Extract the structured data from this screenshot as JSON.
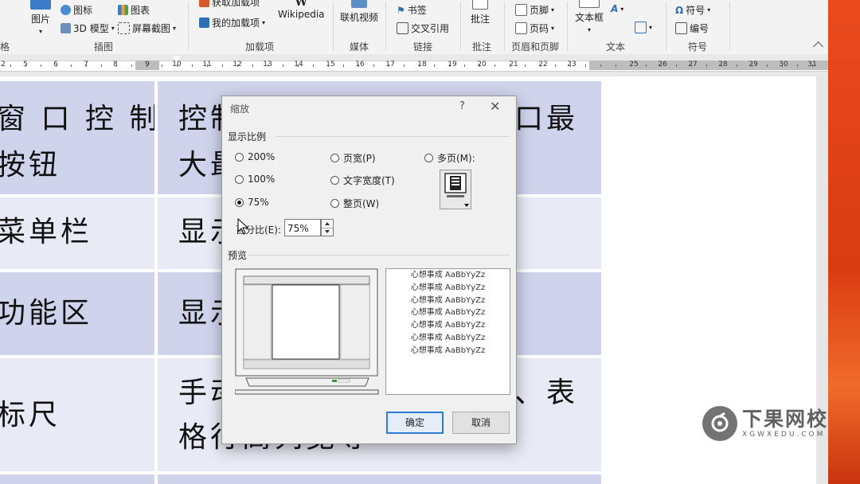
{
  "ribbon": {
    "items": [
      {
        "label": "图片"
      },
      {
        "label": "图标"
      },
      {
        "label": "3D 模型"
      },
      {
        "label": "图表"
      },
      {
        "label": "屏幕截图"
      },
      {
        "label": "获取加载项"
      },
      {
        "label": "我的加载项"
      },
      {
        "label": "Wikipedia"
      },
      {
        "label": "联机视频"
      },
      {
        "label": "书签"
      },
      {
        "label": "交叉引用"
      },
      {
        "label": "批注"
      },
      {
        "label": "页脚"
      },
      {
        "label": "页码"
      },
      {
        "label": "文本框"
      },
      {
        "label": "符号"
      },
      {
        "label": "编号"
      }
    ],
    "groups": [
      {
        "label": "格"
      },
      {
        "label": "插图"
      },
      {
        "label": "加载项"
      },
      {
        "label": "媒体"
      },
      {
        "label": "链接"
      },
      {
        "label": "批注"
      },
      {
        "label": "页眉和页脚"
      },
      {
        "label": "文本"
      },
      {
        "label": "符号"
      }
    ]
  },
  "ruler": {
    "numbers": [
      "1",
      "2",
      "4",
      "5",
      "6",
      "7",
      "8",
      "9",
      "10",
      "11",
      "12",
      "13",
      "14",
      "15",
      "16",
      "17",
      "18",
      "19",
      "20",
      "21",
      "22",
      "23",
      "25",
      "26",
      "27",
      "28",
      "29",
      "30",
      "31",
      "32"
    ]
  },
  "table": {
    "rows": [
      {
        "left": "窗口控制按钮",
        "left_line1": "窗 口 控 制",
        "left_line2": "按钮",
        "right_line1": "控制",
        "right_line2": "大最",
        "right_tail": "口最"
      },
      {
        "left": "菜单栏",
        "right_line1": "显示"
      },
      {
        "left": "功能区",
        "right_line1": "显示"
      },
      {
        "left": "标尺",
        "right_line1": "手动",
        "right_line2": "格行高列宽等",
        "right_tail": "、表"
      }
    ]
  },
  "dialog": {
    "title": "缩放",
    "help": "?",
    "close": "✕",
    "zoom_section": "显示比例",
    "options": [
      {
        "label": "200%",
        "key": "2",
        "selected": false
      },
      {
        "label": "页宽(P)",
        "key": "P",
        "selected": false
      },
      {
        "label": "多页(M):",
        "key": "M",
        "selected": false
      },
      {
        "label": "100%",
        "key": "1",
        "selected": false
      },
      {
        "label": "文字宽度(T)",
        "key": "T",
        "selected": false
      },
      {
        "label": "75%",
        "key": "7",
        "selected": true
      },
      {
        "label": "整页(W)",
        "key": "W",
        "selected": false
      }
    ],
    "percent_label": "百分比(E):",
    "percent_value": "75%",
    "preview_section": "预览",
    "sample_text": "心想事成 AaBbYyZz",
    "sample_lines": [
      "心想事成 AaBbYyZz",
      "心想事成 AaBbYyZz",
      "心想事成 AaBbYyZz",
      "心想事成 AaBbYyZz",
      "心想事成 AaBbYyZz",
      "心想事成 AaBbYyZz",
      "心想事成 AaBbYyZz"
    ],
    "ok": "确定",
    "cancel": "取消"
  },
  "watermark": {
    "cn": "下果网校",
    "en": "XGWXEDU.COM"
  },
  "colors": {
    "row_dark": "#cfd3ec",
    "row_light": "#e8eaf5",
    "accent_orange": "#e14a1e",
    "primary_border": "#2f7bd6"
  }
}
